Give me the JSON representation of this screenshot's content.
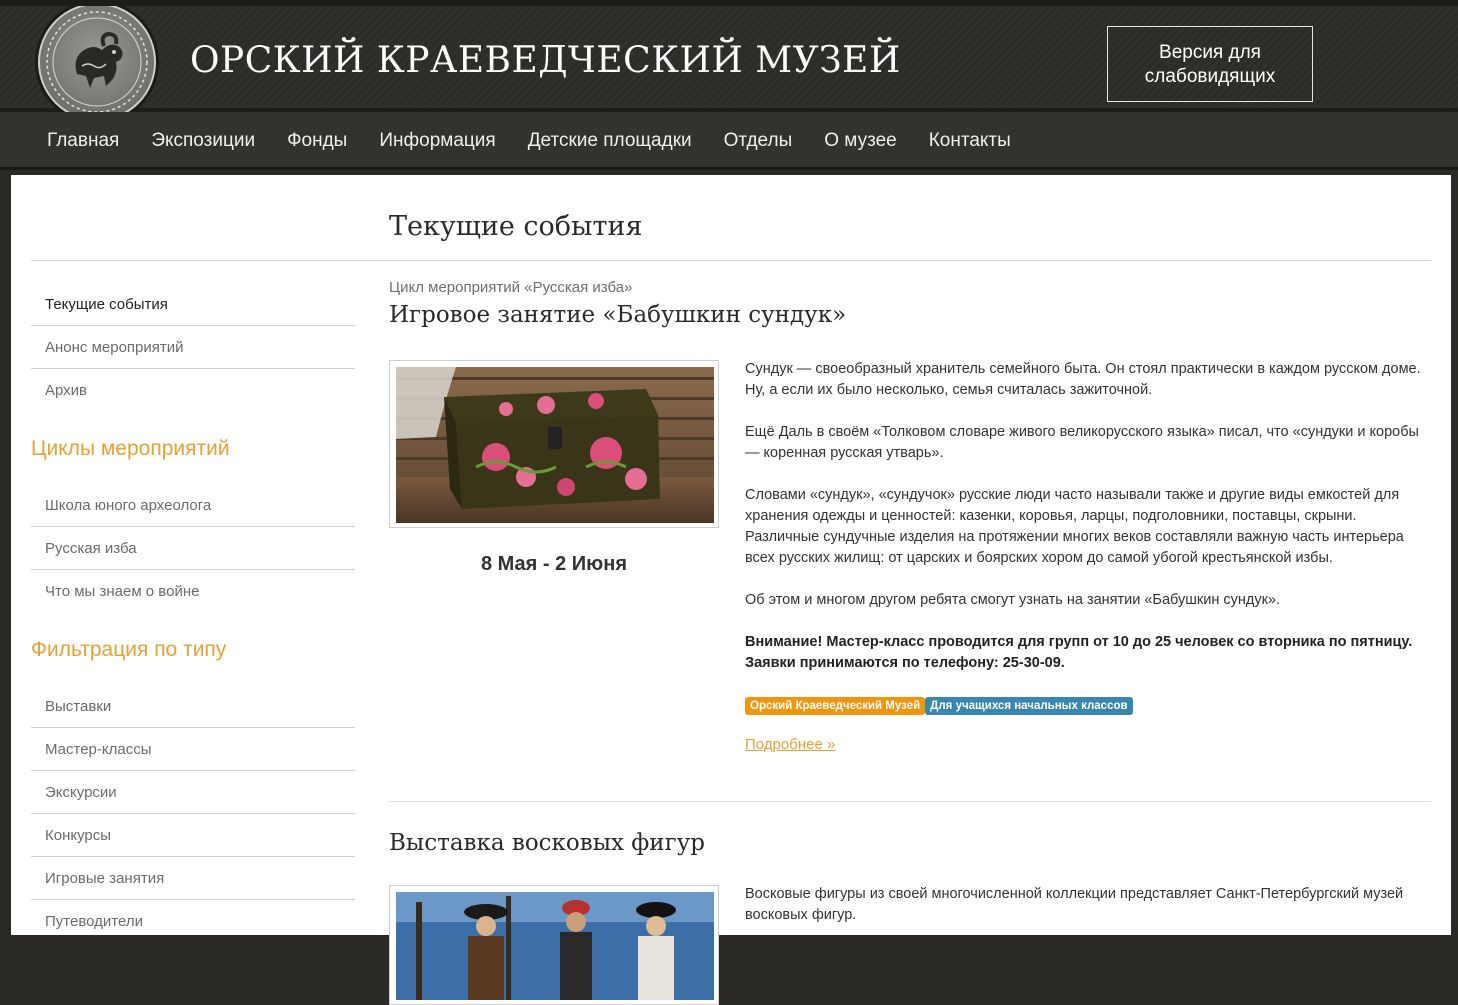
{
  "header": {
    "title": "ОРСКИЙ КРАЕВЕДЧЕСКИЙ МУЗЕЙ",
    "vision_button": {
      "line1": "Версия для",
      "line2": "слабовидящих"
    }
  },
  "nav": {
    "items": [
      {
        "label": "Главная"
      },
      {
        "label": "Экспозиции"
      },
      {
        "label": "Фонды"
      },
      {
        "label": "Информация"
      },
      {
        "label": "Детские площадки"
      },
      {
        "label": "Отделы"
      },
      {
        "label": "О музее"
      },
      {
        "label": "Контакты"
      }
    ]
  },
  "page": {
    "heading": "Текущие события"
  },
  "sidebar": {
    "events": [
      {
        "label": "Текущие события"
      },
      {
        "label": "Анонс мероприятий"
      },
      {
        "label": "Архив"
      }
    ],
    "cycles_heading": "Циклы мероприятий",
    "cycles": [
      {
        "label": "Школа юного археолога"
      },
      {
        "label": "Русская изба"
      },
      {
        "label": "Что мы знаем о войне"
      }
    ],
    "filter_heading": "Фильтрация по типу",
    "types": [
      {
        "label": "Выставки"
      },
      {
        "label": "Мастер-классы"
      },
      {
        "label": "Экскурсии"
      },
      {
        "label": "Конкурсы"
      },
      {
        "label": "Игровые занятия"
      },
      {
        "label": "Путеводители"
      }
    ]
  },
  "events": [
    {
      "cycle": "Цикл мероприятий «Русская изба»",
      "title": "Игровое занятие «Бабушкин сундук»",
      "date": "8 Мая - 2 Июня",
      "paragraphs": [
        "Сундук — своеобразный хранитель семейного быта. Он стоял практически в каждом русском доме. Ну, а если их было несколько, семья считалась зажиточной.",
        "Ещё Даль в своём «Толковом словаре живого великорусского языка» писал, что «сундуки и коробы — коренная русская утварь».",
        "Словами «сундук», «сундучок» русские люди часто называли также и другие виды емкостей для хранения одежды и ценностей: казенки, коровья, ларцы, подголовники, поставцы, скрыни. Различные сундучные изделия на протяжении многих веков составляли важную часть интерьера всех русских жилищ: от царских и боярских хором до самой убогой крестьянской избы.",
        "Об этом и многом другом ребята смогут узнать на занятии «Бабушкин сундук»."
      ],
      "notice": "Внимание! Мастер-класс проводится для групп от 10 до 25 человек со вторника по пятницу. Заявки принимаются по телефону: 25-30-09.",
      "tags": [
        "Орский Краеведческий Музей",
        "Для учащихся начальных классов"
      ],
      "more": "Подробнее »"
    },
    {
      "title": "Выставка восковых фигур",
      "paragraphs": [
        "Восковые фигуры из своей многочисленной коллекции представляет Санкт-Петербургский музей восковых фигур."
      ]
    }
  ],
  "colors": {
    "accent": "#e8a033",
    "tag_orange": "#f0950f",
    "tag_blue": "#3a87ad",
    "header_bg": "#2e2c28"
  }
}
